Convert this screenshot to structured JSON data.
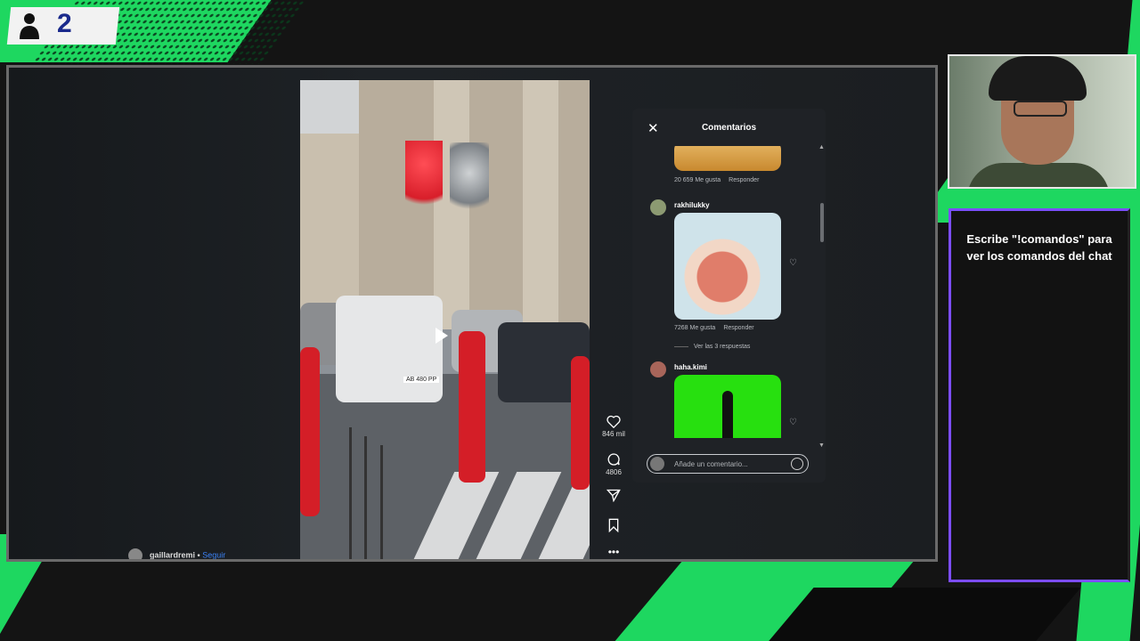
{
  "overlay": {
    "viewer_count": "2",
    "chat_message": "Escribe \"!comandos\" para ver los comandos del chat"
  },
  "video": {
    "author": "gaillardremi",
    "follow_label": "Seguir",
    "plate": "AB 480 PP",
    "actions": {
      "likes": "846 mil",
      "comments": "4806"
    }
  },
  "comments_panel": {
    "title": "Comentarios",
    "items": [
      {
        "username": "",
        "likes": "20 659 Me gusta",
        "reply": "Responder"
      },
      {
        "username": "rakhilukky",
        "likes": "7268 Me gusta",
        "reply": "Responder",
        "replies": "Ver las 3 respuestas"
      },
      {
        "username": "haha.kimi"
      }
    ],
    "input_placeholder": "Añade un comentario..."
  },
  "colors": {
    "accent_green": "#1ed760",
    "chat_border": "#7c4dff",
    "viewer_count": "#1a2a8c"
  },
  "icons": [
    "person-icon",
    "close-icon",
    "heart-icon",
    "comment-icon",
    "share-icon",
    "bookmark-icon",
    "more-icon",
    "play-icon",
    "emoji-icon"
  ]
}
